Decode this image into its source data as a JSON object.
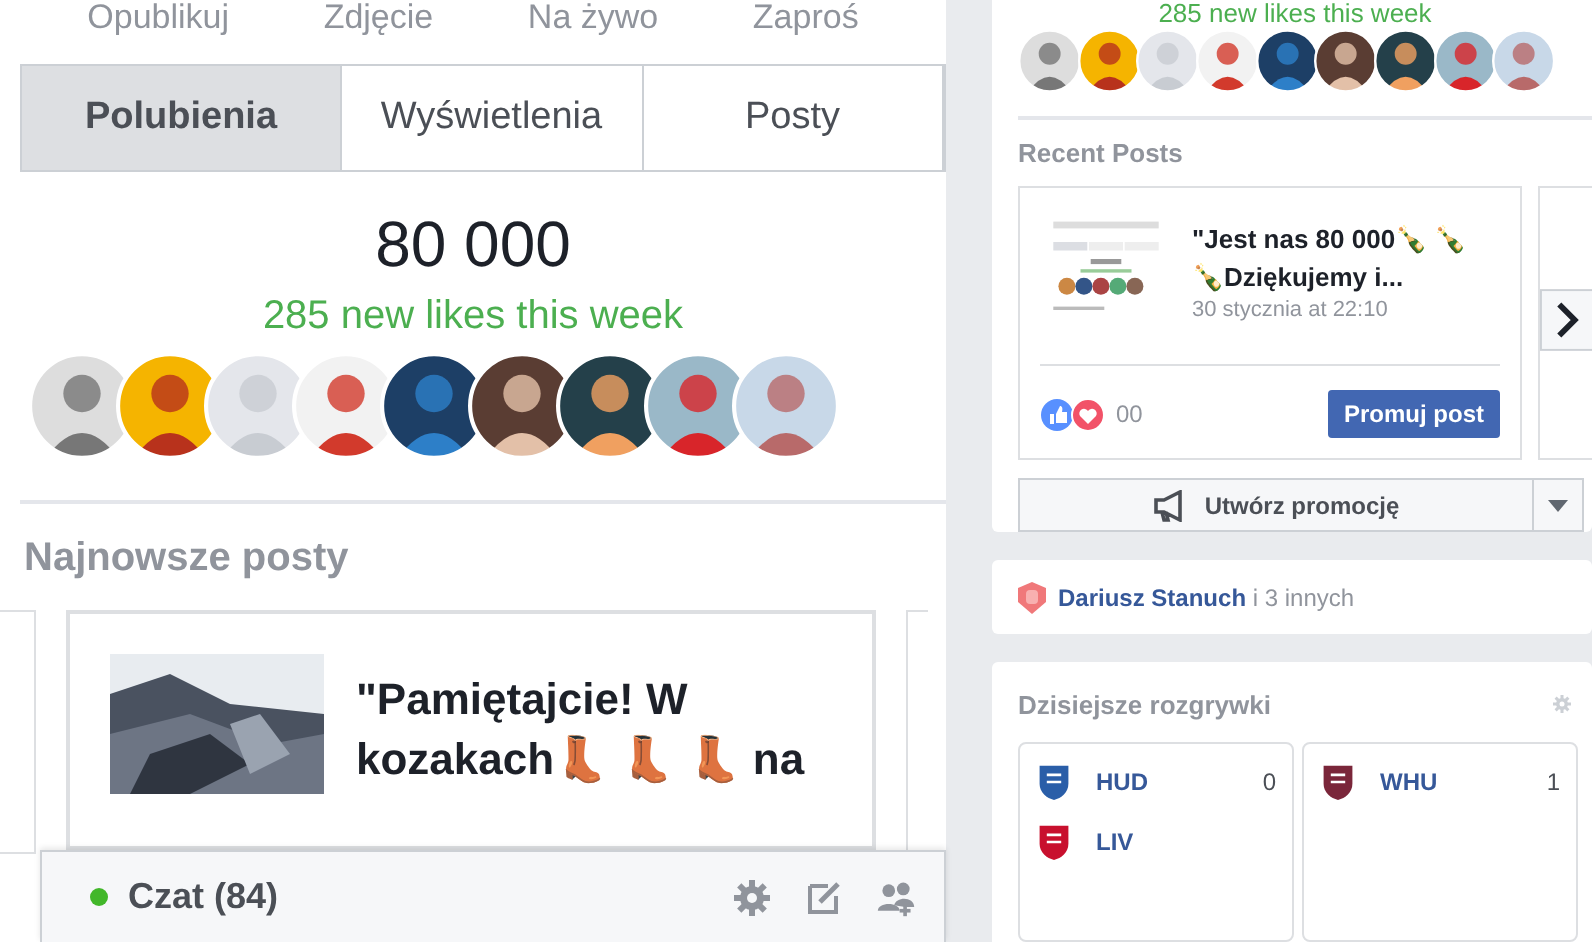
{
  "composer_actions": [
    "Opublikuj",
    "Zdjęcie",
    "Na żywo",
    "Zaproś"
  ],
  "tabs": [
    {
      "label": "Polubienia",
      "selected": true
    },
    {
      "label": "Wyświetlenia",
      "selected": false
    },
    {
      "label": "Posty",
      "selected": false
    }
  ],
  "likes": {
    "count": "80 000",
    "new_this_week": "285 new likes this week"
  },
  "latest_posts": {
    "heading": "Najnowsze posty",
    "post_title": "\"Pamiętajcie! W kozakach👢 👢 👢 na"
  },
  "chat": {
    "label": "Czat (84)",
    "online": true
  },
  "side_likes": {
    "new_this_week": "285 new likes this week"
  },
  "recent_posts": {
    "heading": "Recent Posts",
    "post": {
      "title": "\"Jest nas 80 000🍾 🍾 🍾Dziękujemy i...",
      "date": "30 stycznia at 22:10",
      "reactions": "00",
      "promote_button": "Promuj post"
    },
    "create_promotion": "Utwórz promocję"
  },
  "friends_like": {
    "name": "Dariusz Stanuch",
    "rest": "i 3 innych"
  },
  "matches": {
    "heading": "Dzisiejsze rozgrywki",
    "games": [
      {
        "teams": [
          {
            "name": "HUD",
            "score": "0",
            "color": "#2a5ea8"
          },
          {
            "name": "LIV",
            "color": "#c8102e"
          }
        ]
      },
      {
        "teams": [
          {
            "name": "WHU",
            "score": "1",
            "color": "#7a263a"
          }
        ]
      }
    ]
  }
}
